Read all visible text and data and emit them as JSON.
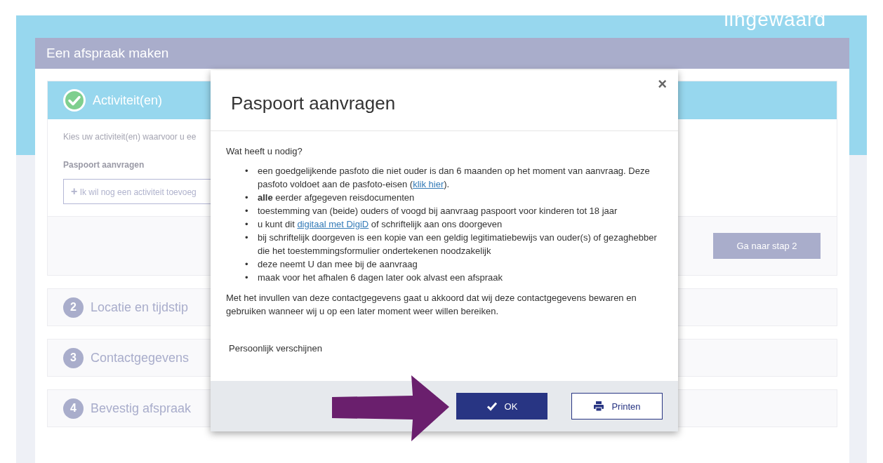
{
  "logo": {
    "text": "lingewaard"
  },
  "page": {
    "title": "Een afspraak maken"
  },
  "steps": [
    {
      "kind": "done",
      "title": "Activiteit(en)",
      "intro": "Kies uw activiteit(en) waarvoor u ee",
      "activity": "Paspoort aanvragen",
      "add_button": {
        "icon": "+",
        "label": "Ik wil nog een activiteit toevoeg"
      },
      "next_button": "Ga naar stap 2"
    },
    {
      "kind": "pending",
      "number": "2",
      "title": "Locatie en tijdstip"
    },
    {
      "kind": "pending",
      "number": "3",
      "title": "Contactgegevens"
    },
    {
      "kind": "pending",
      "number": "4",
      "title": "Bevestig afspraak"
    }
  ],
  "dialog": {
    "title": "Paspoort aanvragen",
    "close": "×",
    "question": "Wat heeft u nodig?",
    "items": [
      {
        "bullet": "•",
        "parts": [
          {
            "kind": "text",
            "text": "een goedgelijkende pasfoto die niet ouder is dan 6 maanden op het moment van aanvraag. Deze pasfoto voldoet aan de pasfoto-eisen ("
          },
          {
            "kind": "link",
            "text": "klik hier"
          },
          {
            "kind": "text",
            "text": ")."
          }
        ]
      },
      {
        "bullet": "•",
        "parts": [
          {
            "kind": "text",
            "text": "**alle** eerder afgegeven reisdocumenten"
          }
        ]
      },
      {
        "bullet": "•",
        "parts": [
          {
            "kind": "text",
            "text": "toestemming van (beide) ouders of voogd bij aanvraag paspoort voor kinderen tot 18 jaar"
          }
        ]
      },
      {
        "bullet": "•",
        "parts": [
          {
            "kind": "text",
            "text": "u kunt dit "
          },
          {
            "kind": "link",
            "text": "digitaal met DigiD"
          },
          {
            "kind": "text",
            "text": " of schriftelijk aan ons doorgeven"
          }
        ]
      },
      {
        "bullet": "•",
        "parts": [
          {
            "kind": "text",
            "text": "bij schriftelijk doorgeven is een kopie van een geldig legitimatiebewijs van ouder(s) of gezaghebber die het toestemmingsformulier ondertekenen noodzakelijk"
          }
        ]
      },
      {
        "bullet": "•",
        "parts": [
          {
            "kind": "text",
            "text": "deze neemt U dan mee bij de aanvraag"
          }
        ]
      },
      {
        "bullet": "•",
        "parts": [
          {
            "kind": "text",
            "text": "maak voor het afhalen 6 dagen later ook alvast een afspraak"
          }
        ]
      }
    ],
    "consent": "Met het invullen van deze contactgegevens gaat u akkoord dat wij deze contactgegevens bewaren en gebruiken wanneer wij u op een later moment weer willen bereiken.",
    "appearance": "Persoonlijk verschijnen",
    "buttons": [
      {
        "kind": "primary",
        "label": "OK"
      },
      {
        "kind": "print",
        "label": "Printen"
      }
    ]
  }
}
